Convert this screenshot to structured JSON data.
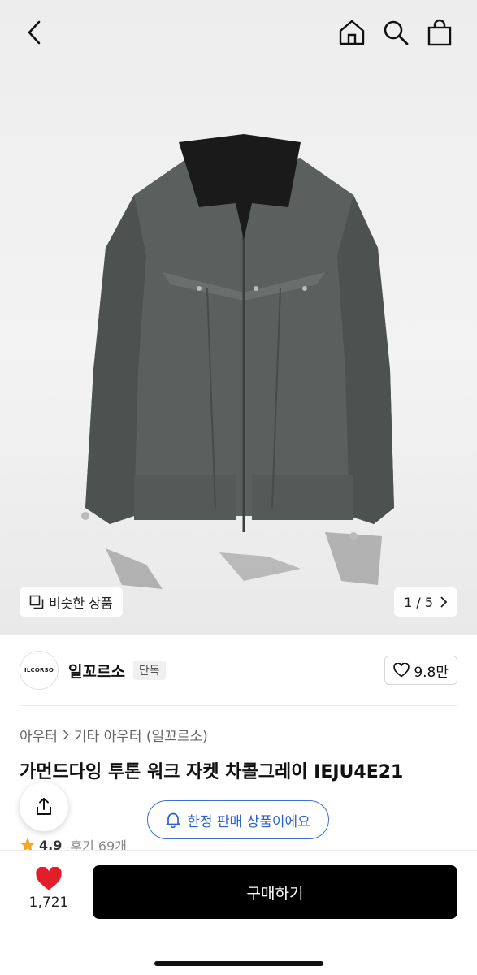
{
  "header": {
    "icons": [
      "back-arrow",
      "home",
      "search",
      "shopping-bag"
    ]
  },
  "gallery": {
    "similar_label": "비슷한 상품",
    "counter": "1 / 5"
  },
  "brand": {
    "logo_text": "ILCORSO",
    "name": "일꼬르소",
    "badge": "단독",
    "likes": "9.8만"
  },
  "product": {
    "breadcrumb": [
      "아우터",
      "기타 아우터 (일꼬르소)"
    ],
    "title": "가먼드다잉 투톤 워크 자켓 차콜그레이 IEJU4E21",
    "limited_label": "한정 판매 상품이에요",
    "rating": "4.9",
    "reviews": "후기 69개"
  },
  "bottom_bar": {
    "heart_count": "1,721",
    "buy_label": "구매하기",
    "heart_color": "#e51d2a"
  },
  "colors": {
    "accent_blue": "#2c62d0",
    "star": "#f5a623"
  }
}
